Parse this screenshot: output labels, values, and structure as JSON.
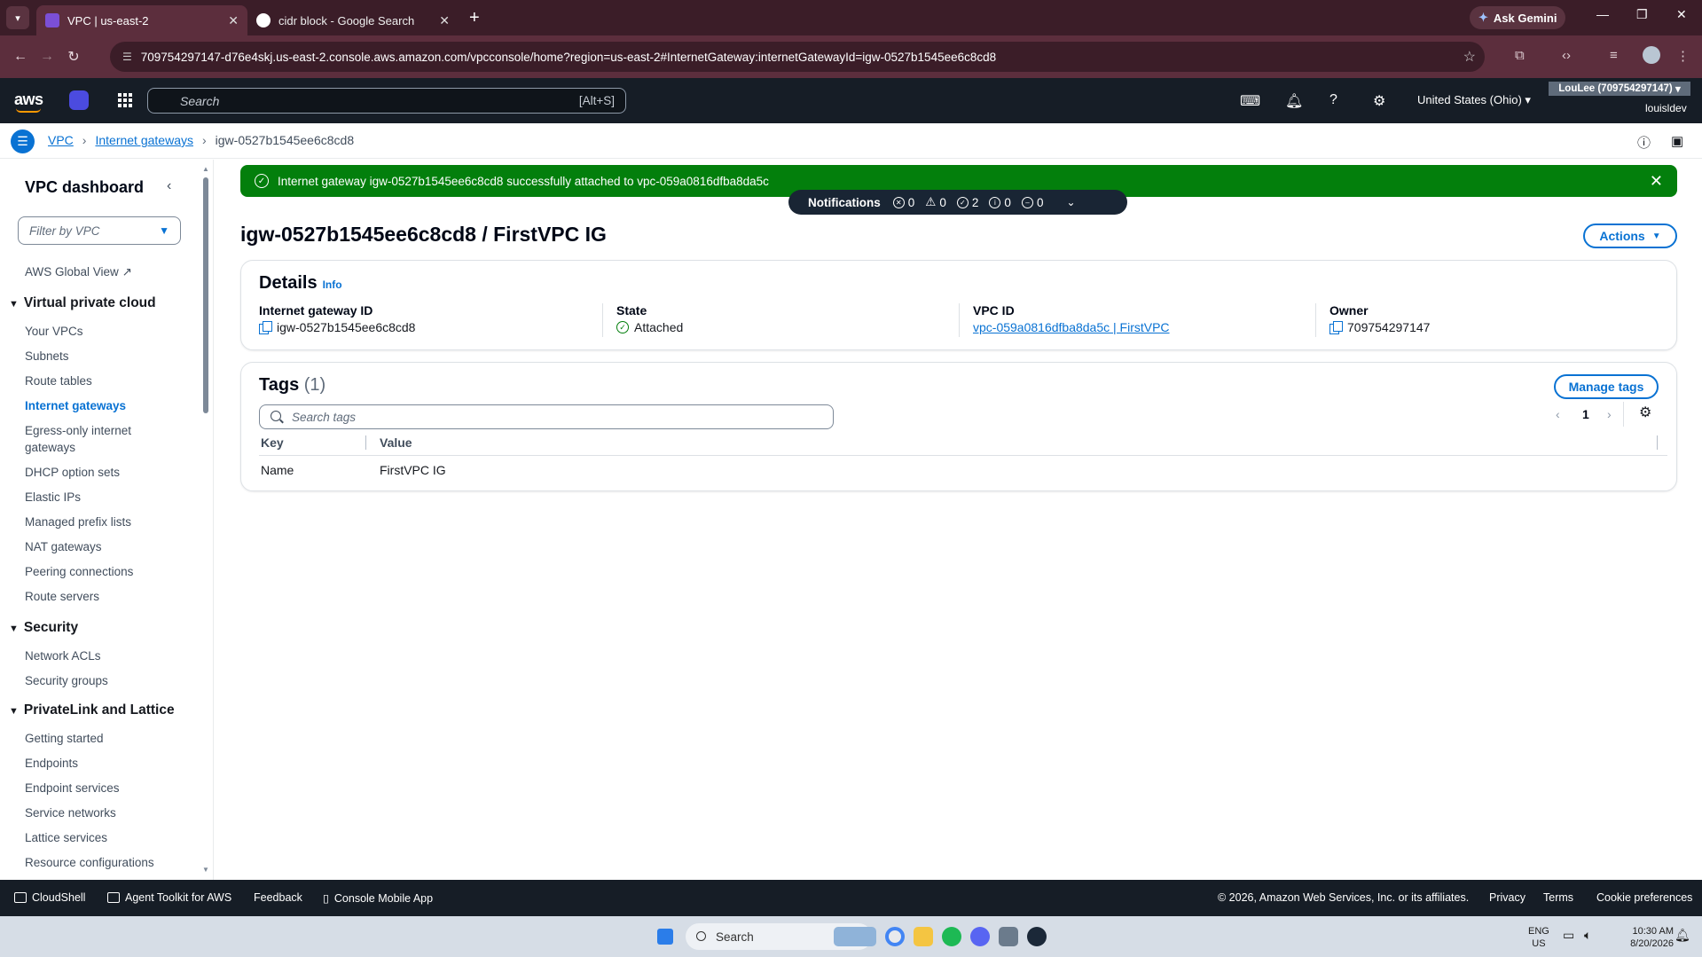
{
  "browser": {
    "tabs": [
      {
        "title": "VPC | us-east-2",
        "active": true
      },
      {
        "title": "cidr block - Google Search",
        "active": false
      }
    ],
    "url": "709754297147-d76e4skj.us-east-2.console.aws.amazon.com/vpcconsole/home?region=us-east-2#InternetGateway:internetGatewayId=igw-0527b1545ee6c8cd8",
    "gemini_label": "Ask Gemini"
  },
  "aws": {
    "logo": "aws",
    "search_placeholder": "Search",
    "search_shortcut": "[Alt+S]",
    "region": "United States (Ohio)",
    "account": "LouLee (709754297147)",
    "user": "louisldev"
  },
  "breadcrumb": {
    "items": [
      "VPC",
      "Internet gateways"
    ],
    "current": "igw-0527b1545ee6c8cd8"
  },
  "sidebar": {
    "title": "VPC dashboard",
    "filter_placeholder": "Filter by VPC",
    "global_view": "AWS Global View",
    "sections": [
      {
        "title": "Virtual private cloud",
        "items": [
          "Your VPCs",
          "Subnets",
          "Route tables",
          "Internet gateways",
          "Egress-only internet gateways",
          "DHCP option sets",
          "Elastic IPs",
          "Managed prefix lists",
          "NAT gateways",
          "Peering connections",
          "Route servers"
        ]
      },
      {
        "title": "Security",
        "items": [
          "Network ACLs",
          "Security groups"
        ]
      },
      {
        "title": "PrivateLink and Lattice",
        "items": [
          "Getting started",
          "Endpoints",
          "Endpoint services",
          "Service networks",
          "Lattice services",
          "Resource configurations"
        ]
      }
    ]
  },
  "flash": {
    "message": "Internet gateway igw-0527b1545ee6c8cd8 successfully attached to vpc-059a0816dfba8da5c"
  },
  "notifications": {
    "label": "Notifications",
    "errors": "0",
    "warnings": "0",
    "success": "2",
    "info": "0",
    "in_progress": "0"
  },
  "page": {
    "title": "igw-0527b1545ee6c8cd8 / FirstVPC IG",
    "actions_label": "Actions"
  },
  "details": {
    "title": "Details",
    "info": "Info",
    "fields": [
      {
        "label": "Internet gateway ID",
        "value": "igw-0527b1545ee6c8cd8"
      },
      {
        "label": "State",
        "value": "Attached"
      },
      {
        "label": "VPC ID",
        "value": "vpc-059a0816dfba8da5c | FirstVPC"
      },
      {
        "label": "Owner",
        "value": "709754297147"
      }
    ]
  },
  "tags": {
    "title": "Tags",
    "count": "(1)",
    "manage_label": "Manage tags",
    "search_placeholder": "Search tags",
    "page": "1",
    "columns": [
      "Key",
      "Value"
    ],
    "rows": [
      {
        "key": "Name",
        "value": "FirstVPC IG"
      }
    ]
  },
  "footer": {
    "cloudshell": "CloudShell",
    "agent_toolkit": "Agent Toolkit for AWS",
    "feedback": "Feedback",
    "mobile_app": "Console Mobile App",
    "copyright": "© 2026, Amazon Web Services, Inc. or its affiliates.",
    "privacy": "Privacy",
    "terms": "Terms",
    "cookies": "Cookie preferences"
  },
  "taskbar": {
    "search_placeholder": "Search",
    "lang_top": "ENG",
    "lang_bottom": "US",
    "time": "10:30 AM",
    "date": "8/20/2026"
  },
  "colors": {
    "accent": "#0972d3",
    "success": "#037f0c",
    "aws_nav": "#161d26",
    "browser_frame": "#5c2e3d"
  }
}
